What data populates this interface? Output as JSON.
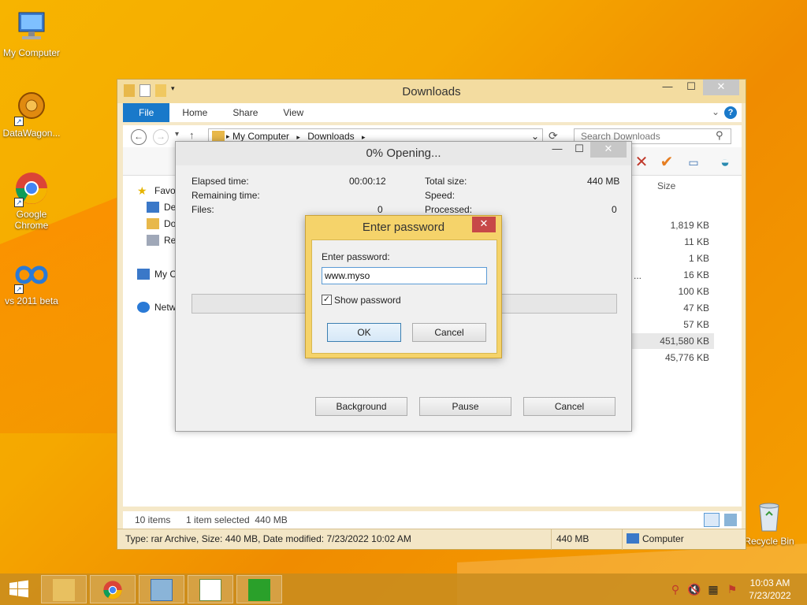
{
  "desktop": {
    "icons": [
      {
        "label": "My Computer"
      },
      {
        "label": "DataWagon..."
      },
      {
        "label": "Google Chrome"
      },
      {
        "label": "vs 2011 beta"
      },
      {
        "label": "Recycle Bin"
      }
    ]
  },
  "explorer": {
    "title": "Downloads",
    "tabs": [
      "File",
      "Home",
      "Share",
      "View"
    ],
    "breadcrumb": [
      "My Computer",
      "Downloads"
    ],
    "search_placeholder": "Search Downloads",
    "nav_items": [
      "Favo",
      "De",
      "Do",
      "Re",
      "My C",
      "Netw"
    ],
    "size_header": "Size",
    "sizes": [
      "1,819 KB",
      "11 KB",
      "1 KB",
      "16 KB",
      "100 KB",
      "47 KB",
      "57 KB",
      "451,580 KB",
      "45,776 KB"
    ],
    "truncated_name": "...",
    "status_items": "10 items",
    "status_selected": "1 item selected  440 MB",
    "details_text": "Type: rar Archive, Size: 440 MB, Date modified: 7/23/2022 10:02 AM",
    "details_size": "440 MB",
    "details_location": "Computer"
  },
  "progress": {
    "title": "0% Opening...",
    "elapsed_label": "Elapsed time:",
    "elapsed_value": "00:00:12",
    "remaining_label": "Remaining time:",
    "files_label": "Files:",
    "files_value": "0",
    "total_label": "Total size:",
    "total_value": "440 MB",
    "speed_label": "Speed:",
    "processed_label": "Processed:",
    "processed_value": "0",
    "buttons": {
      "background": "Background",
      "pause": "Pause",
      "cancel": "Cancel"
    }
  },
  "password_dialog": {
    "title": "Enter password",
    "label": "Enter password:",
    "value": "www.myso",
    "show_password_label": "Show password",
    "show_password_checked": true,
    "ok": "OK",
    "cancel": "Cancel"
  },
  "taskbar": {
    "time": "10:03 AM",
    "date": "7/23/2022"
  }
}
